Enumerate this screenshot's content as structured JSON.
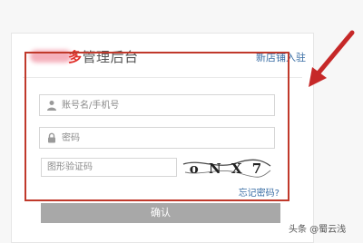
{
  "header": {
    "title_accent": "多",
    "title_rest": "管理后台",
    "store_link": "新店铺入驻"
  },
  "form": {
    "username_placeholder": "账号名/手机号",
    "password_placeholder": "密码",
    "captcha_placeholder": "图形验证码",
    "captcha_text": "o N X 7",
    "forgot_link": "忘记密码?",
    "submit_label": "确认"
  },
  "colors": {
    "highlight_border": "#c0392b",
    "accent_red": "#e0302a",
    "link_blue": "#3a6ea5",
    "submit_button": "#a8a8a8"
  },
  "watermark": "头条 @蜀云浅"
}
